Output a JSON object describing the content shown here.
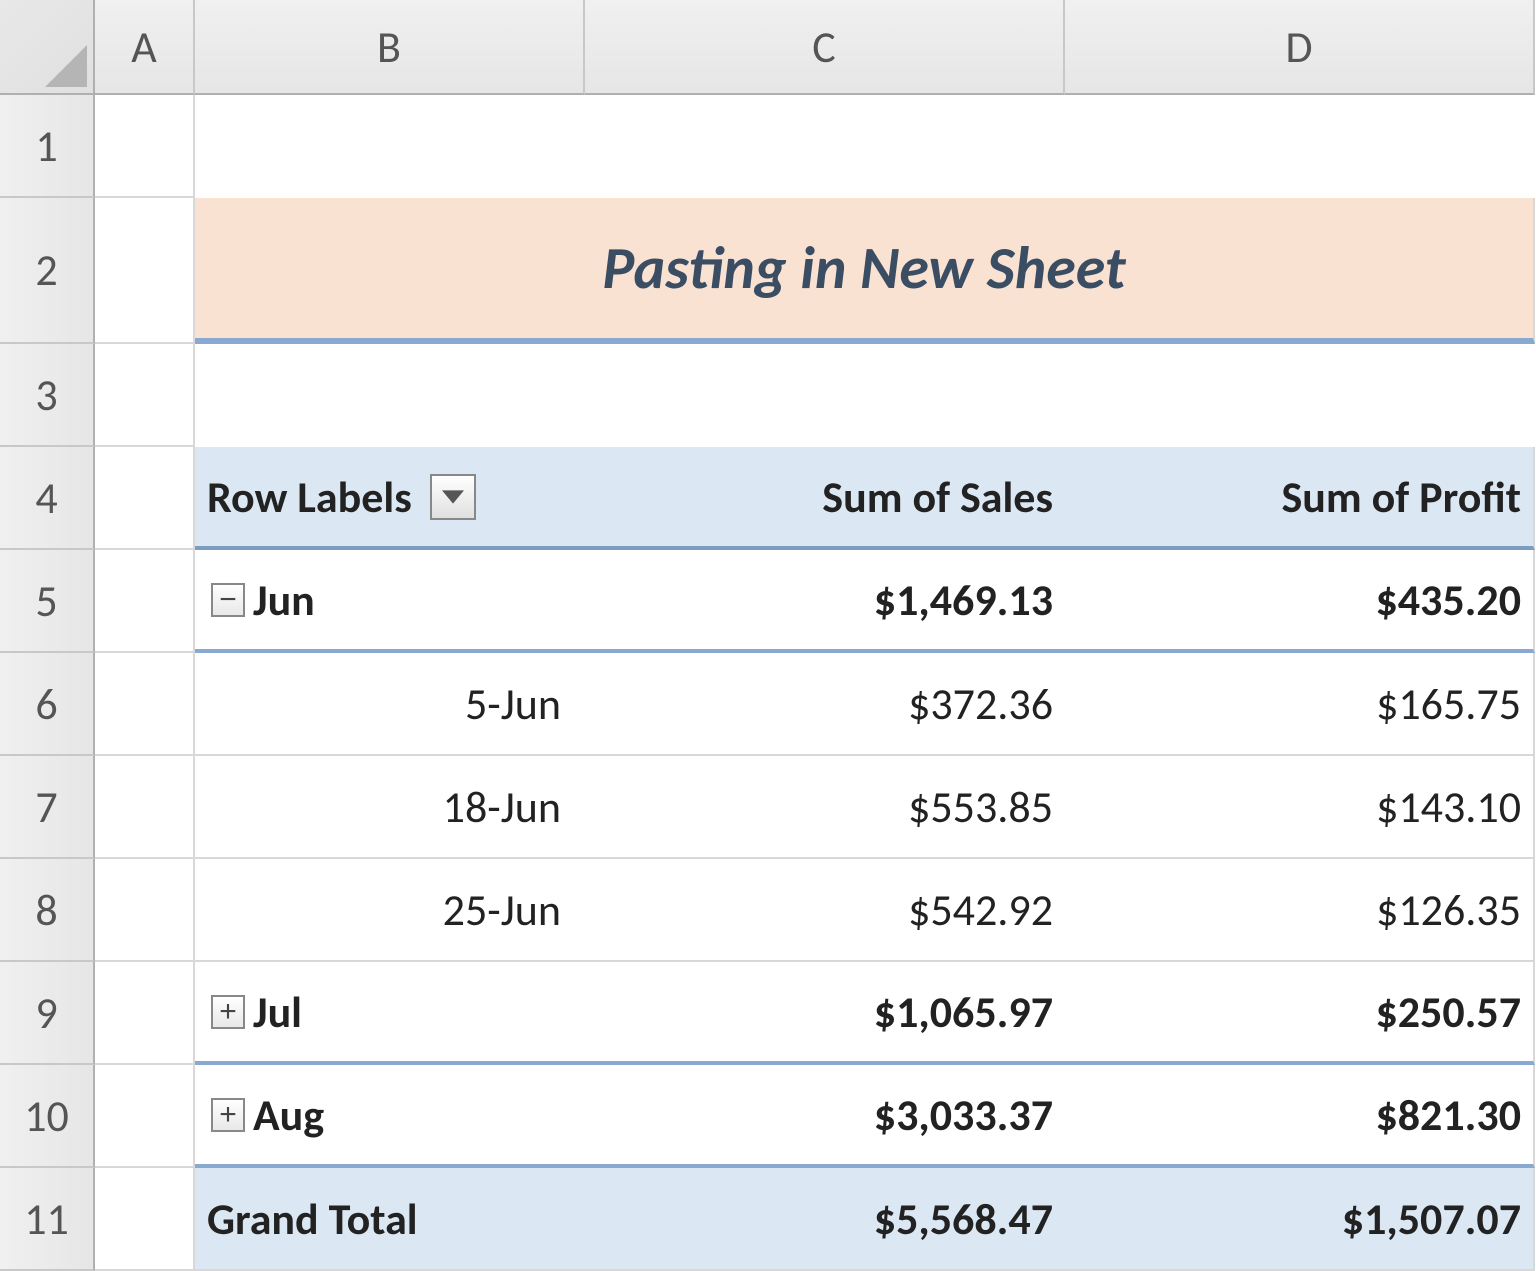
{
  "columns": [
    "A",
    "B",
    "C",
    "D"
  ],
  "row_numbers": [
    "1",
    "2",
    "3",
    "4",
    "5",
    "6",
    "7",
    "8",
    "9",
    "10",
    "11"
  ],
  "title": "Pasting in New Sheet",
  "pivot": {
    "header": {
      "row_labels": "Row Labels",
      "sales": "Sum of Sales",
      "profit": "Sum of Profit"
    },
    "groups": [
      {
        "label": "Jun",
        "expanded": true,
        "sales": "$1,469.13",
        "profit": "$435.20",
        "rows": [
          {
            "label": "5-Jun",
            "sales": "$372.36",
            "profit": "$165.75"
          },
          {
            "label": "18-Jun",
            "sales": "$553.85",
            "profit": "$143.10"
          },
          {
            "label": "25-Jun",
            "sales": "$542.92",
            "profit": "$126.35"
          }
        ]
      },
      {
        "label": "Jul",
        "expanded": false,
        "sales": "$1,065.97",
        "profit": "$250.57"
      },
      {
        "label": "Aug",
        "expanded": false,
        "sales": "$3,033.37",
        "profit": "$821.30"
      }
    ],
    "grand_total": {
      "label": "Grand Total",
      "sales": "$5,568.47",
      "profit": "$1,507.07"
    }
  }
}
